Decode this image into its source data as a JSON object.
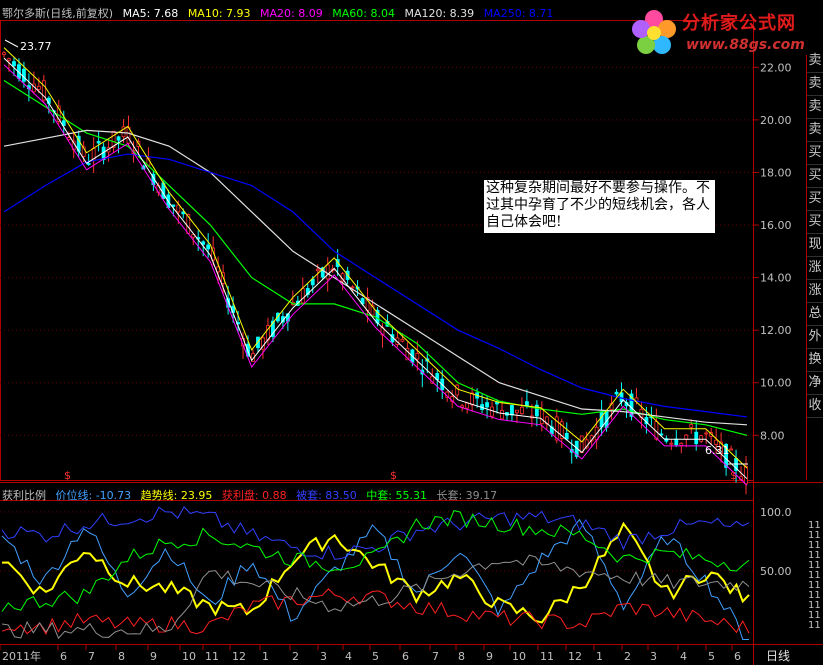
{
  "header": {
    "title": "鄂尔多斯(日线,前复权)",
    "ma": [
      {
        "label": "MA5: 7.68",
        "color": "#ffffff"
      },
      {
        "label": "MA10: 7.93",
        "color": "#ffff00"
      },
      {
        "label": "MA20: 8.09",
        "color": "#ff00ff"
      },
      {
        "label": "MA60: 8.04",
        "color": "#00ff00"
      },
      {
        "label": "MA120: 8.39",
        "color": "#e0e0e0"
      },
      {
        "label": "MA250: 8.71",
        "color": "#0000ff"
      }
    ]
  },
  "indicator": {
    "name": "获利比例",
    "items": [
      {
        "label": "价位线: -10.73",
        "color": "#40a0ff"
      },
      {
        "label": "趋势线: 23.95",
        "color": "#ffff00"
      },
      {
        "label": "获利盘: 0.88",
        "color": "#ff2020"
      },
      {
        "label": "被套: 83.50",
        "color": "#3040ff"
      },
      {
        "label": "中套: 55.31",
        "color": "#00ff00"
      },
      {
        "label": "长套: 39.17",
        "color": "#909090"
      }
    ]
  },
  "annotation": "这种复杂期间最好不要参与操作。不过其中孕育了不少的短线机会，各人自己体会吧!",
  "price_marks": {
    "high": "23.77",
    "low": "6.31"
  },
  "logo": {
    "text": "分析家公式网",
    "url": "www.88gs.com"
  },
  "side_panel": [
    "卖",
    "卖",
    "卖",
    "卖",
    "买",
    "买",
    "买",
    "买",
    "现",
    "涨",
    "涨",
    "总",
    "外",
    "换",
    "净",
    "收"
  ],
  "x_axis": {
    "labels": [
      "2011年",
      "6",
      "7",
      "8",
      "9",
      "10",
      "11",
      "12",
      "1",
      "2",
      "3",
      "4",
      "5",
      "6",
      "7",
      "8",
      "9",
      "10",
      "11",
      "12",
      "1",
      "2",
      "3",
      "4",
      "5",
      "6"
    ],
    "period": "日线"
  },
  "right_axis_indicator": [
    "11",
    "11",
    "11",
    "11",
    "11",
    "11",
    "11",
    "11",
    "11",
    "11",
    "11"
  ],
  "chart_data": [
    {
      "type": "line",
      "subtype": "candlestick-with-moving-averages",
      "title": "鄂尔多斯(日线,前复权)",
      "ylim": [
        6.3,
        23.8
      ],
      "yticks": [
        8.0,
        10.0,
        12.0,
        14.0,
        16.0,
        18.0,
        20.0,
        22.0
      ],
      "ytick_labels": [
        "8.00",
        "10.00",
        "12.00",
        "14.00",
        "16.00",
        "18.00",
        "20.00",
        "22.00"
      ],
      "x": [
        "2011年",
        "6",
        "7",
        "8",
        "9",
        "10",
        "11",
        "12",
        "1",
        "2",
        "3",
        "4",
        "5",
        "6",
        "7",
        "8",
        "9",
        "10",
        "11",
        "12",
        "1",
        "2",
        "3",
        "4",
        "5",
        "6"
      ],
      "series": [
        {
          "name": "price",
          "color": "#ff3030",
          "values": [
            22.5,
            21.0,
            18.5,
            19.5,
            17.0,
            15.0,
            11.0,
            13.0,
            14.5,
            12.5,
            11.0,
            9.5,
            9.0,
            8.8,
            7.5,
            9.5,
            8.0,
            8.0,
            6.5
          ]
        },
        {
          "name": "MA60",
          "color": "#00ff00",
          "values": [
            21.5,
            20.5,
            19.5,
            19.0,
            17.5,
            16.0,
            14.0,
            13.0,
            13.0,
            12.5,
            11.5,
            10.0,
            9.3,
            9.0,
            8.8,
            9.0,
            8.6,
            8.4,
            8.0
          ]
        },
        {
          "name": "MA120",
          "color": "#e0e0e0",
          "values": [
            19.0,
            19.3,
            19.6,
            19.5,
            19.0,
            18.0,
            16.5,
            15.0,
            14.0,
            13.0,
            12.0,
            11.0,
            10.0,
            9.5,
            9.0,
            8.9,
            8.7,
            8.5,
            8.4
          ]
        },
        {
          "name": "MA250",
          "color": "#0000ff",
          "values": [
            16.5,
            17.5,
            18.4,
            18.7,
            18.5,
            18.0,
            17.5,
            16.5,
            15.0,
            14.0,
            13.0,
            12.0,
            11.3,
            10.5,
            9.8,
            9.4,
            9.1,
            8.9,
            8.7
          ]
        }
      ]
    },
    {
      "type": "line",
      "title": "获利比例",
      "ylim": [
        0,
        110
      ],
      "yticks": [
        50,
        100
      ],
      "ytick_labels": [
        "50.00",
        "100.0"
      ],
      "series": [
        {
          "name": "价位线",
          "color": "#40a0ff",
          "values": [
            80,
            40,
            90,
            30,
            70,
            20,
            60,
            10,
            50,
            85,
            30,
            70,
            15,
            60,
            90,
            20,
            80,
            40,
            -10
          ]
        },
        {
          "name": "趋势线",
          "color": "#ffff00",
          "values": [
            60,
            30,
            70,
            40,
            35,
            20,
            15,
            60,
            80,
            55,
            30,
            45,
            20,
            10,
            40,
            85,
            30,
            50,
            24
          ]
        },
        {
          "name": "获利盘",
          "color": "#ff2020",
          "values": [
            5,
            3,
            8,
            4,
            5,
            3,
            20,
            25,
            30,
            28,
            20,
            15,
            10,
            8,
            5,
            20,
            15,
            8,
            1
          ]
        },
        {
          "name": "被套",
          "color": "#3040ff",
          "values": [
            85,
            80,
            90,
            95,
            100,
            95,
            80,
            70,
            65,
            70,
            85,
            90,
            95,
            95,
            90,
            75,
            85,
            90,
            84
          ]
        },
        {
          "name": "中套",
          "color": "#00ff00",
          "values": [
            20,
            25,
            30,
            60,
            75,
            80,
            70,
            60,
            55,
            60,
            90,
            95,
            90,
            85,
            80,
            60,
            65,
            60,
            55
          ]
        },
        {
          "name": "长套",
          "color": "#909090",
          "values": [
            0,
            0,
            0,
            0,
            0,
            50,
            40,
            30,
            20,
            25,
            35,
            50,
            60,
            55,
            50,
            45,
            40,
            40,
            39
          ]
        }
      ]
    }
  ]
}
